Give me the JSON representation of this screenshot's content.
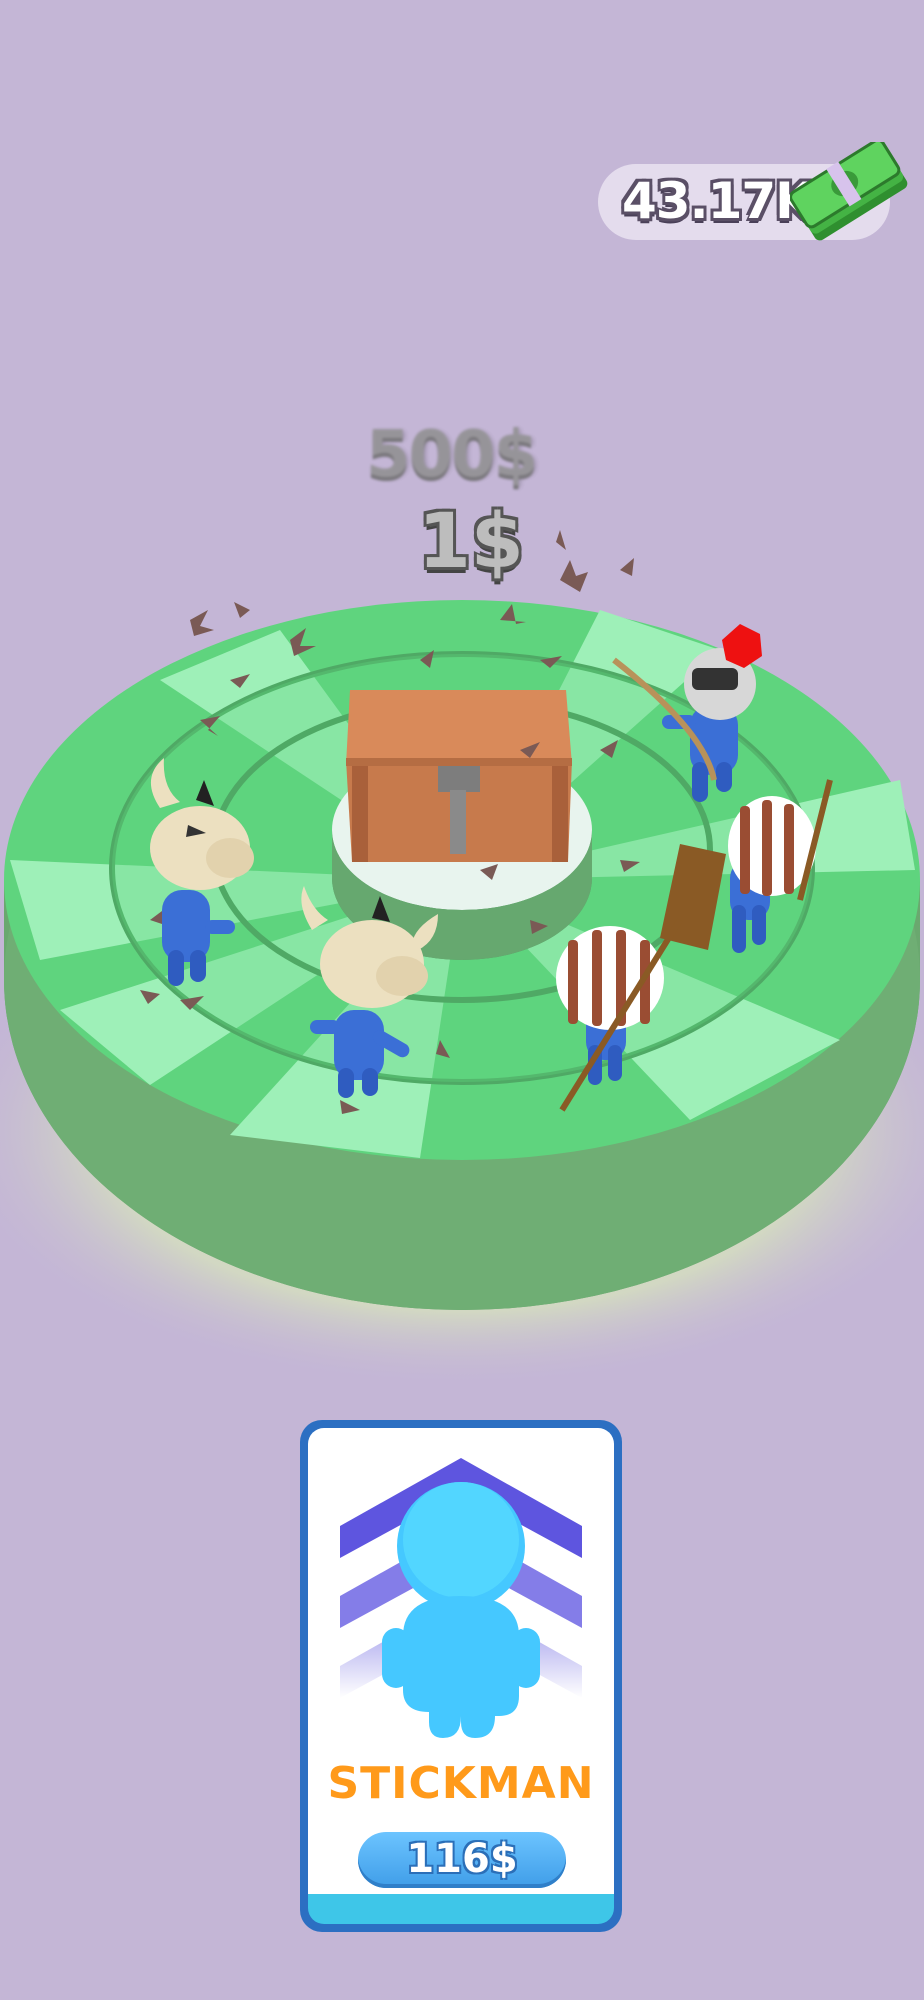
{
  "hud": {
    "money": "43.17K",
    "money_icon": "cash-stack-icon"
  },
  "floating_texts": {
    "big_price": "500$",
    "small_price": "1$"
  },
  "unit_card": {
    "name": "STICKMAN",
    "price": "116$",
    "icon": "stickman-upgrade-icon"
  },
  "colors": {
    "background": "#c4b6d6",
    "arena_green": "#5fd47e",
    "arena_light": "#9ef0b8",
    "card_border": "#2c6fc2",
    "card_title": "#ff9a1a",
    "price_button": "#4aa8ef"
  }
}
